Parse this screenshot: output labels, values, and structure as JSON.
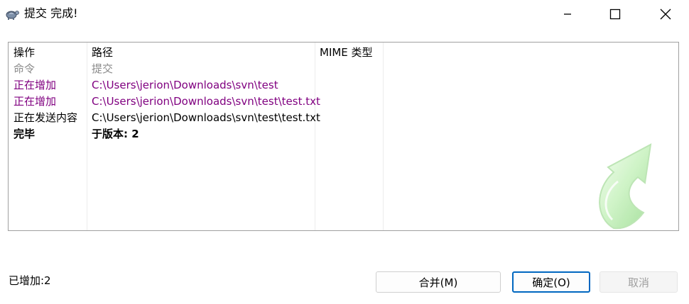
{
  "window": {
    "title": "提交 完成!"
  },
  "list": {
    "columns": [
      "操作",
      "路径",
      "MIME 类型"
    ],
    "rows": [
      {
        "action": "命令",
        "path": "提交",
        "style": "gray"
      },
      {
        "action": "正在增加",
        "path": "C:\\Users\\jerion\\Downloads\\svn\\test",
        "style": "purple"
      },
      {
        "action": "正在增加",
        "path": "C:\\Users\\jerion\\Downloads\\svn\\test\\test.txt",
        "style": "purple"
      },
      {
        "action": "正在发送内容",
        "path": "C:\\Users\\jerion\\Downloads\\svn\\test\\test.txt",
        "style": "black"
      },
      {
        "action": "完毕",
        "path": "于版本: 2",
        "style": "bold"
      }
    ]
  },
  "footer": {
    "status": "已增加:2",
    "merge_label": "合并(M)",
    "ok_label": "确定(O)",
    "cancel_label": "取消"
  },
  "colors": {
    "gray": "#8a8a8a",
    "purple": "#800080",
    "accent": "#0067c0"
  },
  "icons": {
    "app": "tortoise-icon",
    "minimize": "minimize-icon",
    "maximize": "maximize-icon",
    "close": "close-icon",
    "commit_arrow": "commit-arrow-icon"
  }
}
